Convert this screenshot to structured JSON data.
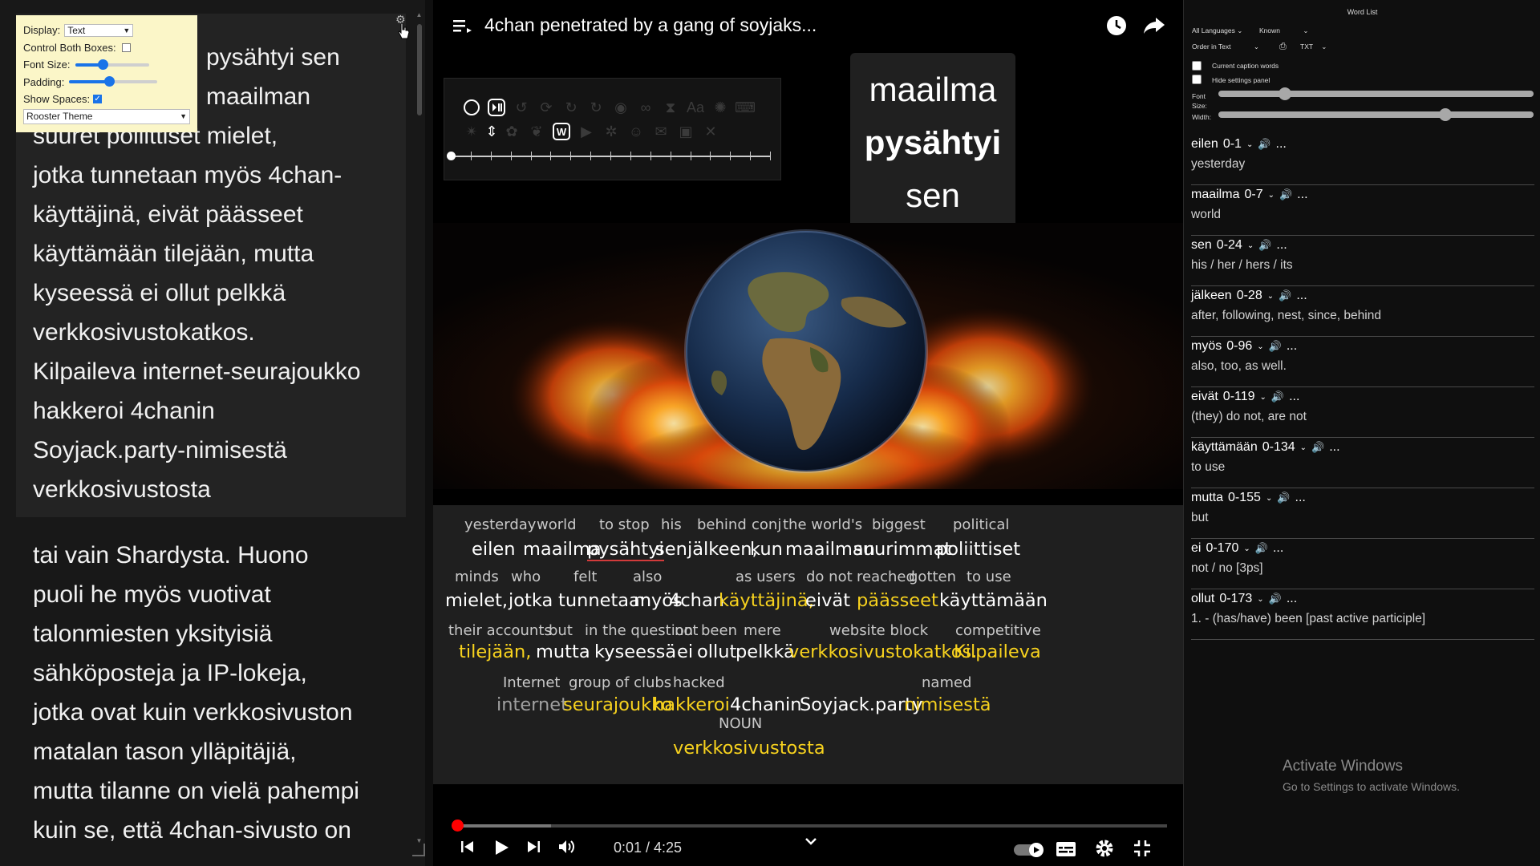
{
  "left_panel": {
    "text_box_1_lines": [
      "pysähtyi sen",
      "maailman",
      "suuret poliittiset mielet,",
      "jotka tunnetaan myös 4chan-",
      "käyttäjinä, eivät päässeet",
      "käyttämään tilejään, mutta",
      "kyseessä ei ollut pelkkä",
      "verkkosivustokatkos.",
      "Kilpaileva internet-seurajoukko",
      "hakkeroi 4chanin",
      "Soyjack.party-nimisestä",
      "verkkosivustosta"
    ],
    "text_box_2_lines": [
      "tai vain Shardysta. Huono",
      "puoli he myös vuotivat",
      "talonmiesten yksityisiä",
      "sähköposteja ja IP-lokeja,",
      "jotka ovat kuin verkkosivuston",
      "matalan tason ylläpitäjiä,",
      "mutta tilanne on vielä pahempi",
      "kuin se, että 4chan-sivusto on"
    ],
    "settings": {
      "display_label": "Display:",
      "display_value": "Text",
      "control_both_label": "Control Both Boxes:",
      "control_both_checked": false,
      "font_size_label": "Font Size:",
      "font_size_level": 0.38,
      "padding_label": "Padding:",
      "padding_level": 0.45,
      "show_spaces_label": "Show Spaces:",
      "show_spaces_checked": true,
      "theme_value": "Rooster Theme"
    }
  },
  "player": {
    "title": "4chan penetrated by a gang of soyjaks...",
    "word_card": [
      "maailma",
      "pysähtyi",
      "sen"
    ],
    "time": "0:01 / 4:25",
    "progress_played_fraction": 0.004,
    "progress_loaded_fraction": 0.137,
    "toolbar_slider_level": 0.0
  },
  "subtitles": {
    "gloss": {
      "yesterday": "yesterday",
      "world": "world",
      "to_stop": "to stop",
      "his": "his",
      "behind": "behind",
      "conj": "conj",
      "worlds": "the world's",
      "biggest": "biggest",
      "political": "political",
      "minds": "minds",
      "who": "who",
      "felt": "felt",
      "also": "also",
      "as_users": "as users",
      "do_not": "do not",
      "reached": "reached",
      "gotten": "gotten",
      "to_use": "to use",
      "their_accounts": "their accounts",
      "but": "but",
      "in_question": "in the question",
      "not": "not",
      "been": "been",
      "mere": "mere",
      "website_block": "website block",
      "competitive": "competitive",
      "internet": "Internet",
      "group_of_clubs": "group of clubs",
      "hacked": "hacked",
      "named": "named",
      "noun": "NOUN"
    },
    "finnish": {
      "eilen": "eilen",
      "maailma": "maailma",
      "pysahtyi": "pysähtyi",
      "sen": "sen",
      "jalkeen": "jälkeen,",
      "kun": "kun",
      "maailman": "maailman",
      "suurimmat": "suurimmat",
      "poliittiset": "poliittiset",
      "mielet": "mielet,",
      "jotka": "jotka",
      "tunnetaan": "tunnetaan",
      "myos": "myös",
      "fourchan": "4chan",
      "kayttajina": "käyttäjinä,",
      "eivat": "eivät",
      "paasseet": "päässeet",
      "kayttamaan": "käyttämään",
      "tilejaan": "tilejään,",
      "mutta": "mutta",
      "kyseessa": "kyseessä",
      "ei": "ei",
      "ollut": "ollut",
      "pelkka": "pelkkä",
      "verkkosivustokatkos": "verkkosivustokatkos.",
      "kilpaileva": "Kilpaileva",
      "internet": "internet",
      "seurajoukko": "seurajoukko",
      "hakkeroi": "hakkeroi",
      "fourchanin": "4chanin",
      "soyjack": "Soyjack.party",
      "nimisesta": "nimisestä",
      "verkkosivustosta": "verkkosivustosta"
    }
  },
  "word_list": {
    "title": "Word List",
    "languages": "All Languages",
    "known": "Known",
    "order": "Order in Text",
    "format": "TXT",
    "current_caption_label": "Current caption words",
    "hide_settings_label": "Hide settings panel",
    "font_label": "Font",
    "size_label": "Size:",
    "width_label": "Width:",
    "font_size_level": 0.21,
    "width_level": 0.72,
    "entries": [
      {
        "word": "eilen",
        "freq": "0-1",
        "trans": "yesterday"
      },
      {
        "word": "maailma",
        "freq": "0-7",
        "trans": "world"
      },
      {
        "word": "sen",
        "freq": "0-24",
        "trans": "his / her / hers / its"
      },
      {
        "word": "jälkeen",
        "freq": "0-28",
        "trans": "after, following, nest, since, behind"
      },
      {
        "word": "myös",
        "freq": "0-96",
        "trans": "also, too, as well."
      },
      {
        "word": "eivät",
        "freq": "0-119",
        "trans": "(they) do not, are not"
      },
      {
        "word": "käyttämään",
        "freq": "0-134",
        "trans": "to use"
      },
      {
        "word": "mutta",
        "freq": "0-155",
        "trans": "but"
      },
      {
        "word": "ei",
        "freq": "0-170",
        "trans": "not / no [3ps]"
      },
      {
        "word": "ollut",
        "freq": "0-173",
        "trans": "1. - (has/have) been [past active participle]"
      }
    ],
    "more": "...",
    "activate_title": "Activate Windows",
    "activate_sub": "Go to Settings to activate Windows."
  },
  "colors": {
    "highlight_yellow": "#f7d21e",
    "progress_red": "#ff0000",
    "settings_bg": "#fbf6c8",
    "speaker_blue": "#6fa8dc"
  },
  "icons": [
    "playlist-icon",
    "clock-icon",
    "share-icon",
    "gear-icon",
    "skip-previous-icon",
    "play-icon",
    "skip-next-icon",
    "volume-icon",
    "autoplay-toggle-icon",
    "captions-icon",
    "settings-icon",
    "exit-fullscreen-icon",
    "speaker-icon"
  ]
}
